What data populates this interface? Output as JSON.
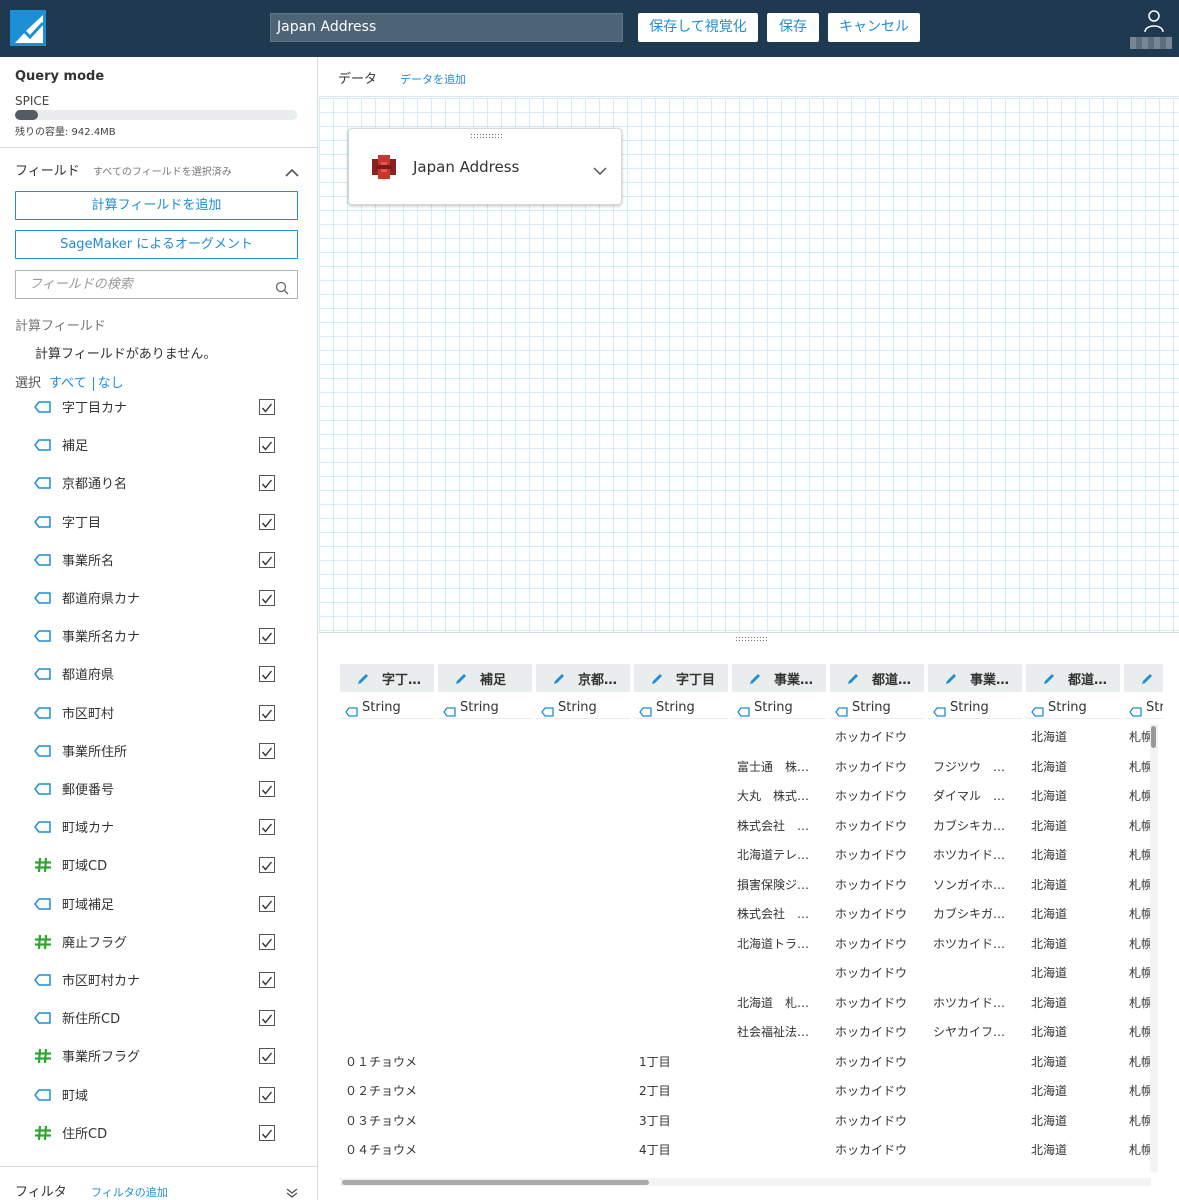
{
  "header": {
    "dataset_name": "Japan Address",
    "save_visualize_label": "保存して視覚化",
    "save_label": "保存",
    "cancel_label": "キャンセル"
  },
  "left_panel": {
    "query_mode_title": "Query mode",
    "query_mode_value": "SPICE",
    "capacity_used_percent": 8,
    "capacity_text": "残りの容量: 942.4MB",
    "fields_title": "フィールド",
    "fields_subtitle": "すべてのフィールドを選択済み",
    "add_calc_field_label": "計算フィールドを追加",
    "sagemaker_label": "SageMaker によるオーグメント",
    "search_placeholder": "フィールドの検索",
    "calc_fields_title": "計算フィールド",
    "calc_fields_empty": "計算フィールドがありません。",
    "select_label": "選択",
    "select_all": "すべて",
    "select_none": "なし",
    "fields": [
      {
        "name": "字丁目カナ",
        "type": "string",
        "checked": true
      },
      {
        "name": "補足",
        "type": "string",
        "checked": true
      },
      {
        "name": "京都通り名",
        "type": "string",
        "checked": true
      },
      {
        "name": "字丁目",
        "type": "string",
        "checked": true
      },
      {
        "name": "事業所名",
        "type": "string",
        "checked": true
      },
      {
        "name": "都道府県カナ",
        "type": "string",
        "checked": true
      },
      {
        "name": "事業所名カナ",
        "type": "string",
        "checked": true
      },
      {
        "name": "都道府県",
        "type": "string",
        "checked": true
      },
      {
        "name": "市区町村",
        "type": "string",
        "checked": true
      },
      {
        "name": "事業所住所",
        "type": "string",
        "checked": true
      },
      {
        "name": "郵便番号",
        "type": "string",
        "checked": true
      },
      {
        "name": "町域カナ",
        "type": "string",
        "checked": true
      },
      {
        "name": "町域CD",
        "type": "number",
        "checked": true
      },
      {
        "name": "町域補足",
        "type": "string",
        "checked": true
      },
      {
        "name": "廃止フラグ",
        "type": "number",
        "checked": true
      },
      {
        "name": "市区町村カナ",
        "type": "string",
        "checked": true
      },
      {
        "name": "新住所CD",
        "type": "string",
        "checked": true
      },
      {
        "name": "事業所フラグ",
        "type": "number",
        "checked": true
      },
      {
        "name": "町域",
        "type": "string",
        "checked": true
      },
      {
        "name": "住所CD",
        "type": "number",
        "checked": true
      }
    ],
    "filter_title": "フィルタ",
    "filter_add": "フィルタの追加"
  },
  "data_area": {
    "title": "データ",
    "add_data": "データを追加",
    "source_card_name": "Japan Address"
  },
  "grid": {
    "columns": [
      {
        "name": "字丁…",
        "type": "String"
      },
      {
        "name": "補足",
        "type": "String"
      },
      {
        "name": "京都…",
        "type": "String"
      },
      {
        "name": "字丁目",
        "type": "String"
      },
      {
        "name": "事業…",
        "type": "String"
      },
      {
        "name": "都道…",
        "type": "String"
      },
      {
        "name": "事業…",
        "type": "String"
      },
      {
        "name": "都道…",
        "type": "String"
      },
      {
        "name": "",
        "type": "Str"
      }
    ],
    "rows": [
      [
        "",
        "",
        "",
        "",
        "",
        "ホッカイドウ",
        "",
        "北海道",
        "札幌"
      ],
      [
        "",
        "",
        "",
        "",
        "富士通　株…",
        "ホッカイドウ",
        "フジツウ　…",
        "北海道",
        "札幌"
      ],
      [
        "",
        "",
        "",
        "",
        "大丸　株式…",
        "ホッカイドウ",
        "ダイマル　…",
        "北海道",
        "札幌"
      ],
      [
        "",
        "",
        "",
        "",
        "株式会社　…",
        "ホッカイドウ",
        "カブシキカ…",
        "北海道",
        "札幌"
      ],
      [
        "",
        "",
        "",
        "",
        "北海道テレ…",
        "ホッカイドウ",
        "ホツカイド…",
        "北海道",
        "札幌"
      ],
      [
        "",
        "",
        "",
        "",
        "損害保険ジ…",
        "ホッカイドウ",
        "ソンガイホ…",
        "北海道",
        "札幌"
      ],
      [
        "",
        "",
        "",
        "",
        "株式会社　…",
        "ホッカイドウ",
        "カブシキガ…",
        "北海道",
        "札幌"
      ],
      [
        "",
        "",
        "",
        "",
        "北海道トラ…",
        "ホッカイドウ",
        "ホツカイド…",
        "北海道",
        "札幌"
      ],
      [
        "",
        "",
        "",
        "",
        "",
        "ホッカイドウ",
        "",
        "北海道",
        "札幌"
      ],
      [
        "",
        "",
        "",
        "",
        "北海道　札…",
        "ホッカイドウ",
        "ホツカイド…",
        "北海道",
        "札幌"
      ],
      [
        "",
        "",
        "",
        "",
        "社会福祉法…",
        "ホッカイドウ",
        "シヤカイフ…",
        "北海道",
        "札幌"
      ],
      [
        "０１チョウメ",
        "",
        "",
        "1丁目",
        "",
        "ホッカイドウ",
        "",
        "北海道",
        "札幌"
      ],
      [
        "０２チョウメ",
        "",
        "",
        "2丁目",
        "",
        "ホッカイドウ",
        "",
        "北海道",
        "札幌"
      ],
      [
        "０３チョウメ",
        "",
        "",
        "3丁目",
        "",
        "ホッカイドウ",
        "",
        "北海道",
        "札幌"
      ],
      [
        "０４チョウメ",
        "",
        "",
        "4丁目",
        "",
        "ホッカイドウ",
        "",
        "北海道",
        "札幌"
      ]
    ]
  },
  "colors": {
    "topbar": "#1f3a50",
    "accent": "#1f8dd6",
    "number_icon": "#2ea62e",
    "s3_red": "#c7372f"
  },
  "icons": {
    "logo": "quicksight-logo-icon",
    "user": "user-icon",
    "search": "search-icon",
    "string_field": "string-tag-icon",
    "number_field": "hash-icon",
    "edit": "pencil-icon",
    "source": "s3-bucket-icon"
  }
}
